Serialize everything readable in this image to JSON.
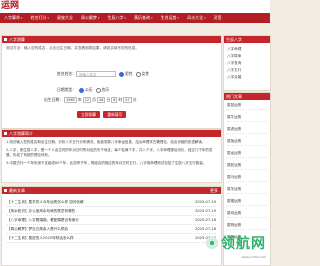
{
  "site": {
    "logo": "运网"
  },
  "nav": [
    {
      "label": "八字算命",
      "caret": true
    },
    {
      "label": "姓名打分",
      "caret": true
    },
    {
      "label": "星座大全",
      "caret": false
    },
    {
      "label": "周公解梦",
      "caret": true
    },
    {
      "label": "生辰八字",
      "caret": true
    },
    {
      "label": "黄历查询",
      "caret": true
    },
    {
      "label": "生肖运势",
      "caret": true
    },
    {
      "label": "风水大全",
      "caret": true
    },
    {
      "label": "灵签",
      "caret": false
    }
  ],
  "form_panel": {
    "title": "八字测算",
    "notice": "测试方法：输入您的姓名，点击出生日期，并查看测算结果，请如实填写您的信息。",
    "name_label": "姓名姓名：",
    "name_placeholder": "请输入姓名",
    "gender_male": "男性",
    "gender_female": "女性",
    "date_type_label": "日期类型：",
    "date_solar": "公历",
    "date_lunar": "农历",
    "birth_label": "出生日期：",
    "year": "1985",
    "year_unit": "年",
    "month": "12",
    "month_unit": "月",
    "day": "26",
    "day_unit": "日",
    "hour": "8",
    "hour_unit": "时",
    "minute": "07",
    "minute_unit": "分",
    "submit": "立即测算",
    "reset": "重新填写"
  },
  "intro_panel": {
    "title": "八字测算简介",
    "paragraphs": [
      "1.测试输入您的姓名和出生日期，分析八字五行分布情况，免费测算八字命运信息，结合命理学古籍理论，给出详细的批语解读。",
      "2.八字，即生辰八字，是一个人出生时的年月日时所对应的天干地支，每个柱两个字，共八个字。八字命理源远流长，经过几千年的发展，形成了系统的理论体系。",
      "3.中国古代一个年份用干支组成60个年，比如甲子年，再组合的相应的年月日时五行，八字测命理测试包括了生辰八字五行数量。"
    ]
  },
  "articles_panel": {
    "title": "最新文章",
    "more": "更多",
    "items": [
      {
        "title": "【十二生肖】属羊的人今年运势怎么样 如何化解",
        "date": "2025-07-19"
      },
      {
        "title": "【风水知识】办公室风水布局的禁忌有哪些",
        "date": "2025-07-19"
      },
      {
        "title": "【八字命理】八字看婚姻，看配偶是否有缘分",
        "date": "2025-07-18"
      },
      {
        "title": "【周公解梦】梦见已故亲人是什么预兆",
        "date": "2025-07-18"
      },
      {
        "title": "【十二生肖】属鼠的人2025年财运怎么样",
        "date": "2025-07-17"
      }
    ]
  },
  "sidebar_top": {
    "title": "生辰八字",
    "lines": [
      "八字命理",
      "八字算命",
      "八字查询",
      "八字五行",
      "八字合婚"
    ]
  },
  "sidebar_list": {
    "title": "热门文章",
    "items": [
      "属鼠运势",
      "属牛运势",
      "属虎运势",
      "属兔运势",
      "属龙运势",
      "属蛇运势",
      "属马运势",
      "属羊运势",
      "属猴运势",
      "属鸡运势",
      "属狗运势",
      "属猪运势"
    ]
  },
  "watermark": {
    "text": "领航网",
    "url": "www.cclmh.com"
  }
}
